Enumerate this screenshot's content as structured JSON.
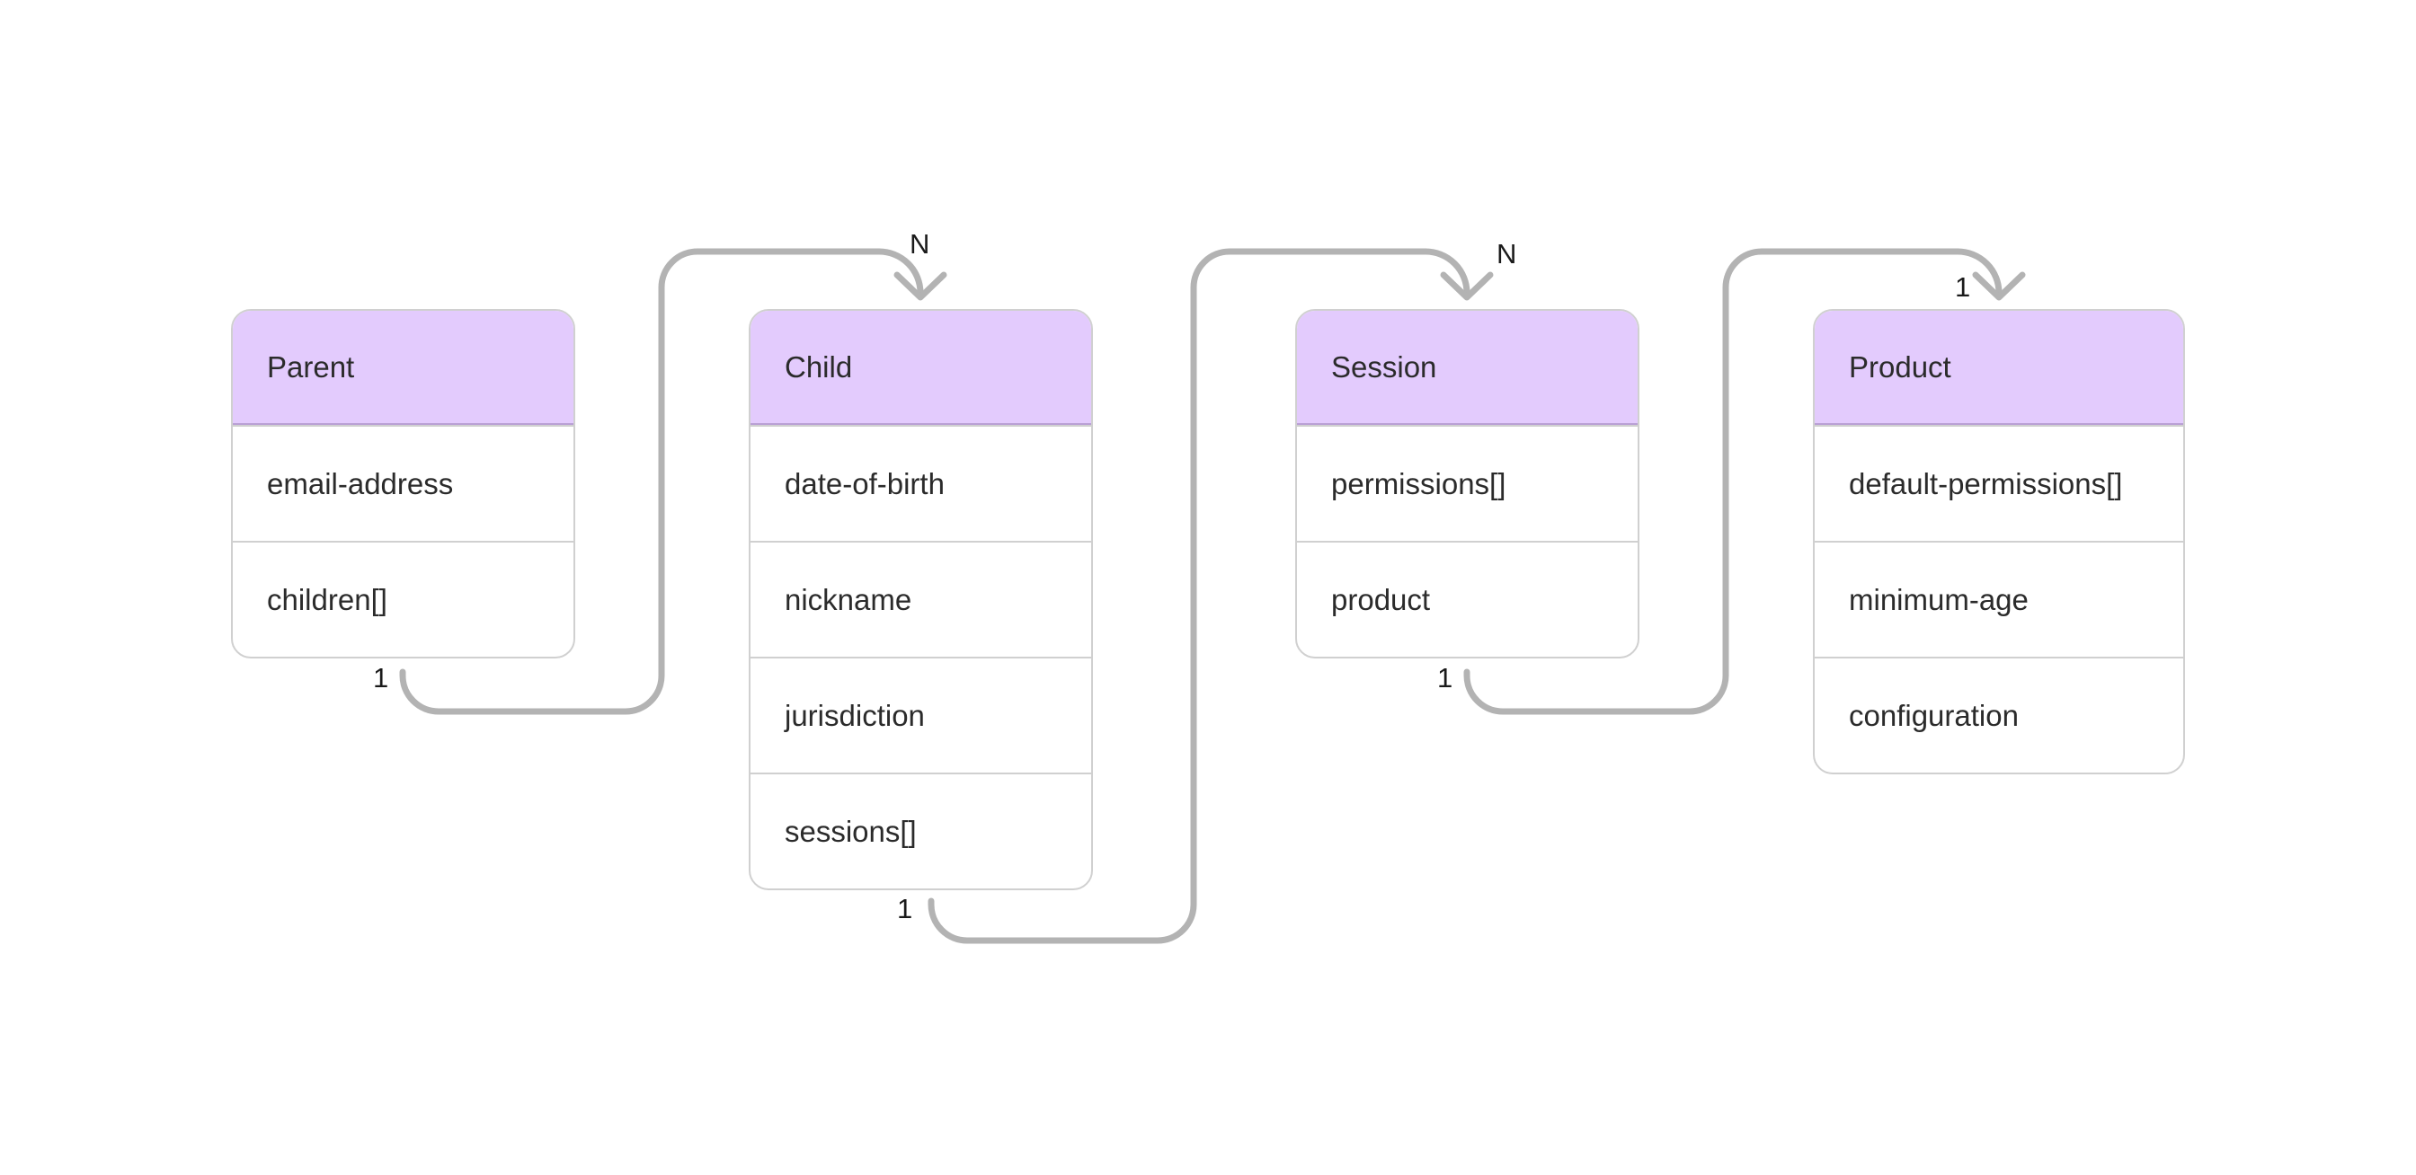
{
  "diagram": {
    "type": "entity-relationship",
    "colors": {
      "header_fill": "#e3cbfd",
      "header_border": "#b9a0d4",
      "box_border": "#d0d0d0",
      "connector": "#b3b3b3",
      "text": "#2b2b2b"
    },
    "entities": [
      {
        "id": "parent",
        "title": "Parent",
        "fields": [
          "email-address",
          "children[]"
        ]
      },
      {
        "id": "child",
        "title": "Child",
        "fields": [
          "date-of-birth",
          "nickname",
          "jurisdiction",
          "sessions[]"
        ]
      },
      {
        "id": "session",
        "title": "Session",
        "fields": [
          "permissions[]",
          "product"
        ]
      },
      {
        "id": "product",
        "title": "Product",
        "fields": [
          "default-permissions[]",
          "minimum-age",
          "configuration"
        ]
      }
    ],
    "relationships": [
      {
        "from": "Parent",
        "to": "Child",
        "from_cardinality": "1",
        "to_cardinality": "N"
      },
      {
        "from": "Child",
        "to": "Session",
        "from_cardinality": "1",
        "to_cardinality": "N"
      },
      {
        "from": "Session",
        "to": "Product",
        "from_cardinality": "1",
        "to_cardinality": "1"
      }
    ]
  }
}
